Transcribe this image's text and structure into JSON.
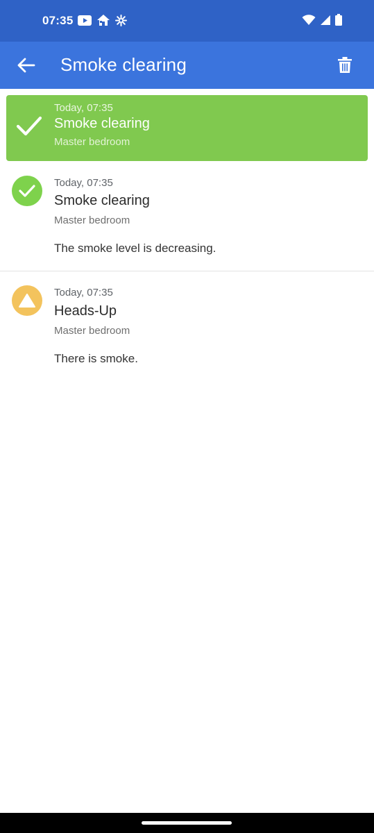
{
  "status_bar": {
    "time": "07:35",
    "left_icons": [
      "youtube-icon",
      "home-icon",
      "fan-icon"
    ],
    "right_icons": [
      "wifi-icon",
      "cell-signal-icon",
      "battery-icon"
    ]
  },
  "app_bar": {
    "title": "Smoke clearing",
    "back_icon": "arrow-back-icon",
    "delete_icon": "trash-icon"
  },
  "banner": {
    "time": "Today, 07:35",
    "title": "Smoke clearing",
    "location": "Master bedroom",
    "color": "#80c94f"
  },
  "events": [
    {
      "time": "Today, 07:35",
      "title": "Smoke clearing",
      "location": "Master bedroom",
      "description": "The smoke level is decreasing.",
      "icon": "check-circle-icon",
      "color": "#7ed24c"
    },
    {
      "time": "Today, 07:35",
      "title": "Heads-Up",
      "location": "Master bedroom",
      "description": "There is smoke.",
      "icon": "warning-triangle-icon",
      "color": "#f3c35d"
    }
  ],
  "colors": {
    "status_bar": "#2f62c6",
    "app_bar": "#3b74dd"
  }
}
